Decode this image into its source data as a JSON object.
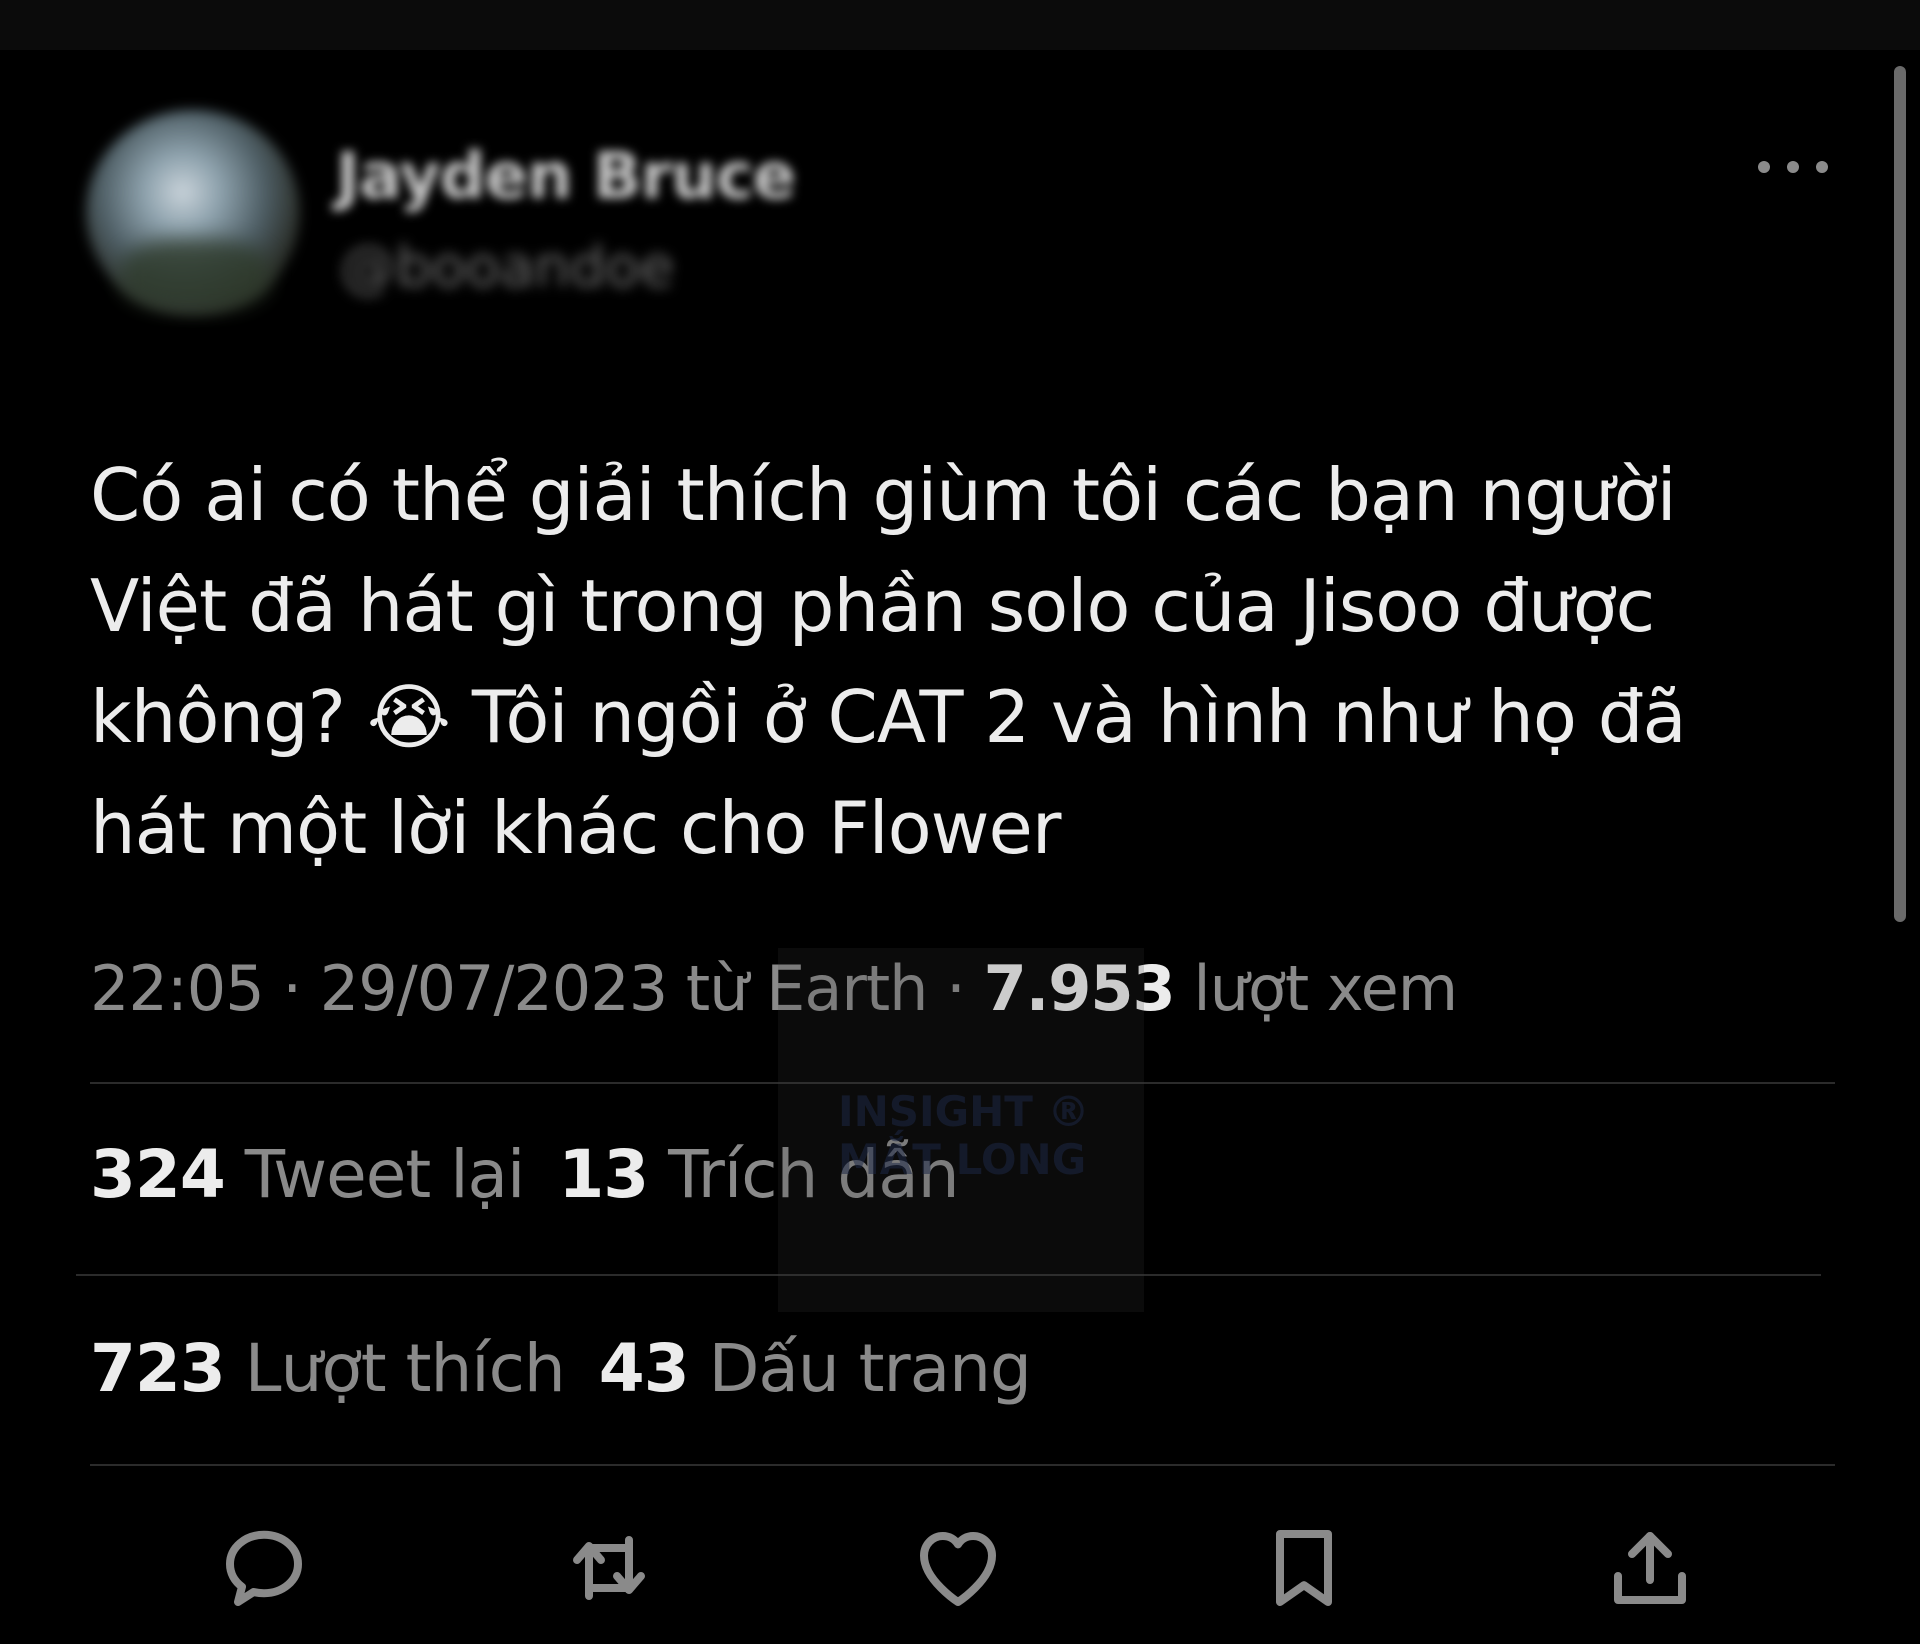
{
  "author": {
    "display_name": "Jayden Bruce",
    "handle": "@booandoe"
  },
  "tweet": {
    "text": "Có ai có thể giải thích giùm tôi các bạn người Việt đã hát gì trong phần solo của Jisoo được không? 😭 Tôi ngồi ở CAT 2 và hình như họ đã hát một lời khác cho Flower"
  },
  "meta": {
    "time_date_source": "22:05 · 29/07/2023 từ Earth · ",
    "views_count": "7.953",
    "views_label": " lượt xem"
  },
  "stats": {
    "retweets_count": "324",
    "retweets_label": " Tweet lại",
    "quotes_count": "13",
    "quotes_label": " Trích dẫn",
    "likes_count": "723",
    "likes_label": " Lượt thích",
    "bookmarks_count": "43",
    "bookmarks_label": " Dấu trang"
  },
  "watermark": {
    "line1": "INSIGHT ®",
    "line2": "MẮT LONG"
  },
  "icons": {
    "more": "more-horizontal-icon",
    "reply": "reply-icon",
    "retweet": "retweet-icon",
    "like": "heart-icon",
    "bookmark": "bookmark-icon",
    "share": "share-icon"
  },
  "colors": {
    "background": "#000000",
    "text_primary": "#ececec",
    "text_secondary": "#8a8a8a",
    "divider": "#2b2b2b"
  }
}
